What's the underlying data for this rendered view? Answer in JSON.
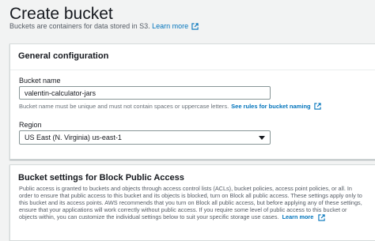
{
  "header": {
    "title": "Create bucket",
    "subtitle": "Buckets are containers for data stored in S3.",
    "learn_more": "Learn more"
  },
  "general_config": {
    "title": "General configuration",
    "bucket_name_label": "Bucket name",
    "bucket_name_value": "valentin-calculator-jars",
    "bucket_name_hint": "Bucket name must be unique and must not contain spaces or uppercase letters.",
    "naming_rules_link": "See rules for bucket naming",
    "region_label": "Region",
    "region_value": "US East (N. Virginia) us-east-1"
  },
  "block_public_access": {
    "title": "Bucket settings for Block Public Access",
    "description": "Public access is granted to buckets and objects through access control lists (ACLs), bucket policies, access point policies, or all. In order to ensure that public access to this bucket and its objects is blocked, turn on Block all public access. These settings apply only to this bucket and its access points. AWS recommends that you turn on Block all public access, but before applying any of these settings, ensure that your applications will work correctly without public access. If you require some level of public access to this bucket or objects within, you can customize the individual settings below to suit your specific storage use cases.",
    "learn_more": "Learn more"
  },
  "colors": {
    "link": "#0073bb",
    "background": "#f2f3f3",
    "text": "#16191f"
  },
  "icons": {
    "external_link": "external-link-icon",
    "dropdown": "caret-down-icon"
  }
}
